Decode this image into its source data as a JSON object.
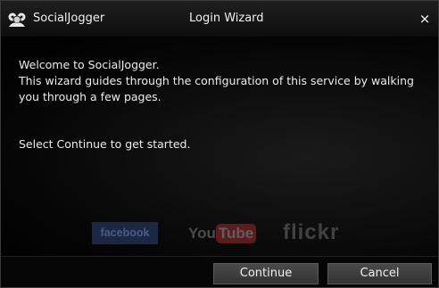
{
  "titlebar": {
    "app_name": "SocialJogger",
    "title": "Login Wizard",
    "close_label": "×",
    "app_icon": "socialjogger-logo-icon",
    "close_icon": "close-icon"
  },
  "content": {
    "welcome_lines": [
      "Welcome to SocialJogger.",
      "This wizard guides through the configuration of this service by walking you through a few pages."
    ],
    "prompt": "Select Continue to get started.",
    "logos": {
      "facebook": "facebook",
      "youtube_you": "You",
      "youtube_tube": "Tube",
      "flickr": "flickr"
    }
  },
  "footer": {
    "continue_label": "Continue",
    "cancel_label": "Cancel"
  },
  "colors": {
    "background": "#000000",
    "text": "#ececec",
    "button_bg": "#3e3e3e",
    "facebook_bg": "#1b2744",
    "youtube_tube_bg": "#5a1c1c"
  }
}
